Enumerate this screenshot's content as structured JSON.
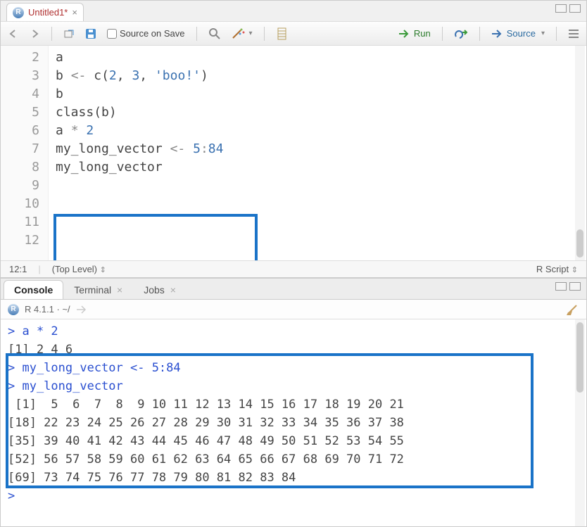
{
  "tab": {
    "title": "Untitled1*",
    "close_glyph": "×"
  },
  "toolbar": {
    "source_on_save": "Source on Save",
    "run": "Run",
    "source": "Source"
  },
  "editor": {
    "lines": [
      {
        "n": "2",
        "html": "<span class='tok-id'>a</span>"
      },
      {
        "n": "3",
        "html": ""
      },
      {
        "n": "4",
        "html": "<span class='tok-id'>b</span> <span class='tok-op'>&lt;-</span> <span class='tok-id'>c</span>(<span class='tok-num'>2</span>, <span class='tok-num'>3</span>, <span class='tok-str'>'boo!'</span>)"
      },
      {
        "n": "5",
        "html": "<span class='tok-id'>b</span>"
      },
      {
        "n": "6",
        "html": "<span class='tok-id'>class</span>(<span class='tok-id'>b</span>)"
      },
      {
        "n": "7",
        "html": ""
      },
      {
        "n": "8",
        "html": "<span class='tok-id'>a</span> <span class='tok-op'>*</span> <span class='tok-num'>2</span>"
      },
      {
        "n": "9",
        "html": ""
      },
      {
        "n": "10",
        "html": "<span class='tok-id'>my_long_vector</span> <span class='tok-op'>&lt;-</span> <span class='tok-num'>5</span><span class='tok-op'>:</span><span class='tok-num'>84</span>"
      },
      {
        "n": "11",
        "html": "<span class='tok-id'>my_long_vector</span>"
      },
      {
        "n": "12",
        "html": ""
      }
    ]
  },
  "status": {
    "pos": "12:1",
    "scope": "(Top Level)",
    "lang": "R Script"
  },
  "console": {
    "tabs": {
      "console": "Console",
      "terminal": "Terminal",
      "jobs": "Jobs"
    },
    "version": "R 4.1.1 · ~/",
    "lines": [
      {
        "cls": "prompt-in",
        "text": "> a * 2"
      },
      {
        "cls": "",
        "text": "[1] 2 4 6"
      },
      {
        "cls": "prompt-in",
        "text": "> my_long_vector <- 5:84"
      },
      {
        "cls": "prompt-in",
        "text": "> my_long_vector"
      },
      {
        "cls": "",
        "text": " [1]  5  6  7  8  9 10 11 12 13 14 15 16 17 18 19 20 21"
      },
      {
        "cls": "",
        "text": "[18] 22 23 24 25 26 27 28 29 30 31 32 33 34 35 36 37 38"
      },
      {
        "cls": "",
        "text": "[35] 39 40 41 42 43 44 45 46 47 48 49 50 51 52 53 54 55"
      },
      {
        "cls": "",
        "text": "[52] 56 57 58 59 60 61 62 63 64 65 66 67 68 69 70 71 72"
      },
      {
        "cls": "",
        "text": "[69] 73 74 75 76 77 78 79 80 81 82 83 84"
      },
      {
        "cls": "prompt-in",
        "text": "> "
      }
    ]
  }
}
